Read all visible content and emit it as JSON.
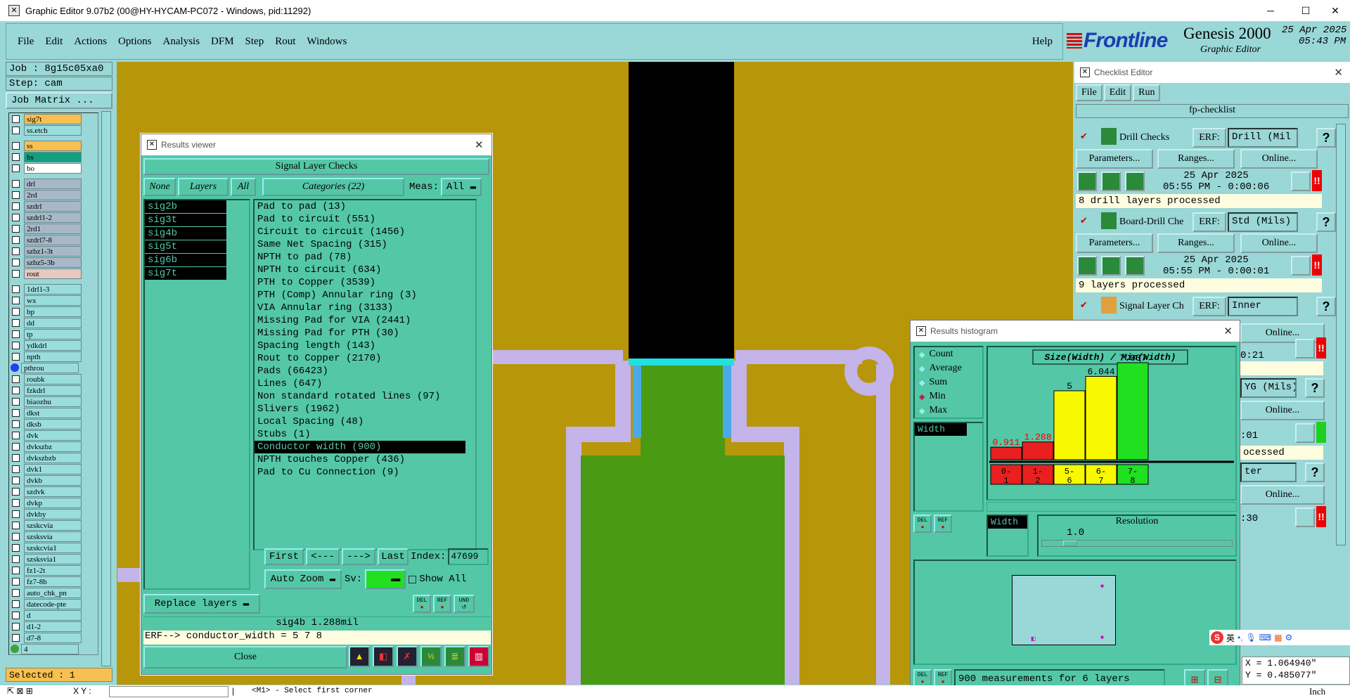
{
  "window": {
    "title": "Graphic Editor 9.07b2 (00@HY-HYCAM-PC072 - Windows, pid:11292)",
    "minimize": "─",
    "maximize": "☐",
    "close": "✕"
  },
  "menu": {
    "items": [
      "File",
      "Edit",
      "Actions",
      "Options",
      "Analysis",
      "DFM",
      "Step",
      "Rout",
      "Windows"
    ],
    "help": "Help"
  },
  "logo": {
    "brand": "Frontline",
    "product": "Genesis 2000",
    "subtitle": "Graphic Editor",
    "date": "25 Apr 2025",
    "time": "05:43 PM"
  },
  "job": {
    "job": "Job : 8g15c05xa0",
    "step": "Step: cam",
    "matrix_button": "Job Matrix ..."
  },
  "layers": [
    {
      "name": "sig7t",
      "color": "#f8c050"
    },
    {
      "name": "ss.etch",
      "color": "#9dd"
    },
    {
      "gap": true
    },
    {
      "name": "ss",
      "color": "#f8c050"
    },
    {
      "name": "bs",
      "color": "#10a080"
    },
    {
      "name": "bo",
      "color": "#fff"
    },
    {
      "gap": true
    },
    {
      "name": "drl",
      "color": "#a8b8c8"
    },
    {
      "name": "2rd",
      "color": "#a8b8c8"
    },
    {
      "name": "szdrl",
      "color": "#a8b8c8"
    },
    {
      "name": "szdrl1-2",
      "color": "#a8b8c8"
    },
    {
      "name": "2rd1",
      "color": "#a8b8c8"
    },
    {
      "name": "szdrl7-8",
      "color": "#a8b8c8"
    },
    {
      "name": "szbz1-3t",
      "color": "#a8b8c8"
    },
    {
      "name": "szbz5-3b",
      "color": "#a8b8c8"
    },
    {
      "name": "rout",
      "color": "#e8c8c0"
    },
    {
      "gap": true
    },
    {
      "name": "1drl1-3",
      "color": "#9dd"
    },
    {
      "name": "wx",
      "color": "#9dd"
    },
    {
      "name": "bp",
      "color": "#9dd"
    },
    {
      "name": "dd",
      "color": "#9dd"
    },
    {
      "name": "tp",
      "color": "#9dd"
    },
    {
      "name": "ydkdrl",
      "color": "#9dd"
    },
    {
      "name": "npth",
      "color": "#9dd"
    },
    {
      "name": "pthrou",
      "color": "#9dd",
      "dot": "#2040f0"
    },
    {
      "name": "roubk",
      "color": "#9dd"
    },
    {
      "name": "fzkdrl",
      "color": "#9dd"
    },
    {
      "name": "biaozhu",
      "color": "#9dd"
    },
    {
      "name": "dkst",
      "color": "#9dd"
    },
    {
      "name": "dksb",
      "color": "#9dd"
    },
    {
      "name": "dvk",
      "color": "#9dd"
    },
    {
      "name": "dvkszbz",
      "color": "#9dd"
    },
    {
      "name": "dvkszbzb",
      "color": "#9dd"
    },
    {
      "name": "dvk1",
      "color": "#9dd"
    },
    {
      "name": "dvkb",
      "color": "#9dd"
    },
    {
      "name": "szdvk",
      "color": "#9dd"
    },
    {
      "name": "dvkp",
      "color": "#9dd"
    },
    {
      "name": "dvkby",
      "color": "#9dd"
    },
    {
      "name": "szskcvia",
      "color": "#9dd"
    },
    {
      "name": "szsksvia",
      "color": "#9dd"
    },
    {
      "name": "szskcvia1",
      "color": "#9dd"
    },
    {
      "name": "szsksvia1",
      "color": "#9dd"
    },
    {
      "name": "fz1-2t",
      "color": "#9dd"
    },
    {
      "name": "fz7-8b",
      "color": "#9dd"
    },
    {
      "name": "auto_chk_pn",
      "color": "#9dd"
    },
    {
      "name": "datecode-pte",
      "color": "#9dd"
    },
    {
      "name": "d",
      "color": "#9dd"
    },
    {
      "name": "d1-2",
      "color": "#9dd"
    },
    {
      "name": "d7-8",
      "color": "#9dd"
    },
    {
      "name": "4",
      "color": "#9dd",
      "dot": "#40a040"
    }
  ],
  "selected": "Selected : 1",
  "results_viewer": {
    "title": "Results viewer",
    "header": "Signal Layer Checks",
    "none": "None",
    "layers": "Layers",
    "all": "All",
    "categories_label": "Categories (22)",
    "meas_label": "Meas:",
    "meas_value": "All",
    "layer_items": [
      "sig2b",
      "sig3t",
      "sig4b",
      "sig5t",
      "sig6b",
      "sig7t"
    ],
    "categories": [
      "Pad to pad (13)",
      "Pad to circuit (551)",
      "Circuit to circuit (1456)",
      "Same Net Spacing (315)",
      "NPTH to pad (78)",
      "NPTH to circuit (634)",
      "PTH to Copper (3539)",
      "PTH (Comp) Annular ring (3)",
      "VIA Annular ring (3133)",
      "Missing Pad for VIA (2441)",
      "Missing Pad for PTH (30)",
      "Spacing length (143)",
      "Rout to Copper (2170)",
      "Pads (66423)",
      "Lines (647)",
      "Non standard rotated lines (97)",
      "Slivers (1962)",
      "Local Spacing (48)",
      "Stubs (1)",
      "Conductor width (900)",
      "NPTH touches Copper (436)",
      "Pad to Cu Connection (9)"
    ],
    "selected_category": 19,
    "nav": {
      "first": "First",
      "prev": "<---",
      "next": "--->",
      "last": "Last",
      "index_label": "Index:",
      "index_value": "47699"
    },
    "auto_zoom": "Auto Zoom",
    "sv_label": "Sv:",
    "show_all": "Show All",
    "replace_layers": "Replace layers",
    "small_buttons": [
      "DEL",
      "REF",
      "UND"
    ],
    "status": "sig4b 1.288mil",
    "erf": "ERF--> conductor_width = 5 7 8",
    "close": "Close"
  },
  "checklist": {
    "title": "Checklist Editor",
    "menu": [
      "File",
      "Edit",
      "Run"
    ],
    "name": "fp-checklist",
    "checks": [
      {
        "name": "Drill Checks",
        "erf_label": "ERF:",
        "erf": "Drill (Mil",
        "params": "Parameters...",
        "ranges": "Ranges...",
        "online": "Online...",
        "date": "25 Apr 2025",
        "time": "05:55 PM - 0:00:06",
        "status": "8 drill layers processed"
      },
      {
        "name": "Board-Drill Che",
        "erf_label": "ERF:",
        "erf": "Std (Mils)",
        "params": "Parameters...",
        "ranges": "Ranges...",
        "online": "Online...",
        "date": "25 Apr 2025",
        "time": "05:55 PM - 0:00:01",
        "status": "9 layers processed"
      },
      {
        "name": "Signal Layer Ch",
        "erf_label": "ERF:",
        "erf": "Inner",
        "online": "Online...",
        "time": "0:21"
      }
    ],
    "partial": {
      "erf4": "YG (Mils)",
      "online4": "Online...",
      "time4": ":01",
      "status4": "ocessed",
      "erf5": "ter",
      "online5": "Online...",
      "time5": ":30"
    }
  },
  "histogram": {
    "title": "Results histogram",
    "options": [
      "Count",
      "Average",
      "Sum",
      "Min",
      "Max"
    ],
    "selected_option": "Min",
    "chart_title": "Size(Width) / Min(Width)",
    "list_item": "Width",
    "resolution_label": "Resolution",
    "resolution_value": "1.0",
    "res_list_item": "Width",
    "summary": "900 measurements for 6 layers",
    "bottom_buttons": [
      "DEL",
      "REF"
    ]
  },
  "chart_data": {
    "type": "bar",
    "categories": [
      "0-1",
      "1-2",
      "5-6",
      "6-7",
      "7-8"
    ],
    "values": [
      0.911,
      1.288,
      5,
      6.044,
      7.037
    ],
    "value_labels": [
      "0.911",
      "1.288",
      "5",
      "6.044",
      "7.037"
    ],
    "title": "Size(Width) / Min(Width)",
    "colors": [
      "#e82020",
      "#e82020",
      "#f8f800",
      "#f8f800",
      "#20e020"
    ]
  },
  "statusbar": {
    "xy_label": "X Y :",
    "message": "<M1> - Select first corner",
    "coord_x": "X = 1.064940\"",
    "coord_y": "Y = 0.485077\"",
    "unit": "Inch"
  },
  "tray": {
    "ime": "英"
  }
}
